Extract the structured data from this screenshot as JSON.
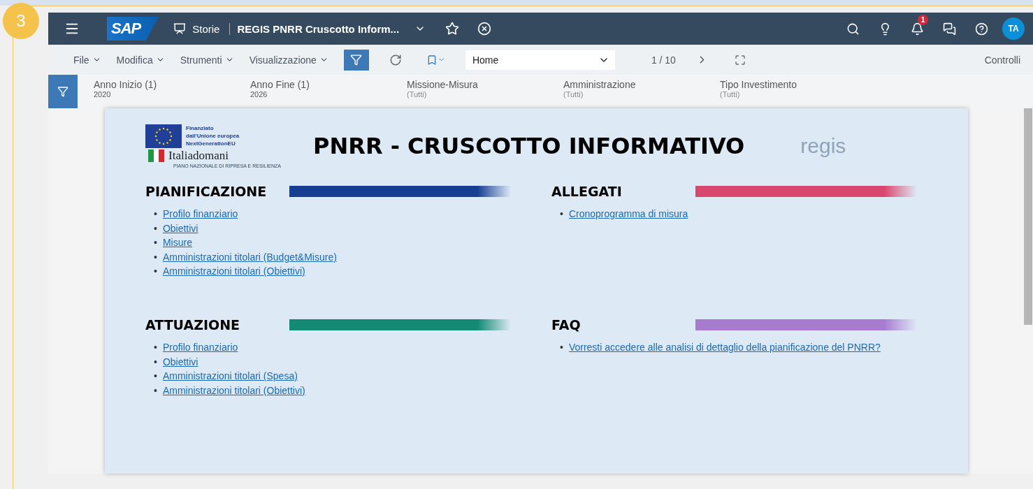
{
  "step": "3",
  "shellbar": {
    "logo": "SAP",
    "app": "Storie",
    "story": "REGIS PNRR Cruscotto Inform...",
    "notifications": "1",
    "avatar": "TA"
  },
  "menubar": {
    "menus": [
      "File",
      "Modifica",
      "Strumenti",
      "Visualizzazione"
    ],
    "page_select": "Home",
    "page": "1 / 10",
    "controls": "Controlli"
  },
  "filters": [
    {
      "label": "Anno Inizio (1)",
      "value": "2020"
    },
    {
      "label": "Anno Fine (1)",
      "value": "2026"
    },
    {
      "label": "Missione-Misura",
      "value": "(Tutti)"
    },
    {
      "label": "Amministrazione",
      "value": "(Tutti)"
    },
    {
      "label": "Tipo Investimento",
      "value": "(Tutti)"
    }
  ],
  "dashboard": {
    "logo": {
      "eu_lines": [
        "Finanziato",
        "dall'Unione europea",
        "NextGenerationEU"
      ],
      "name": "Italiadomani",
      "subtitle": "PIANO NAZIONALE DI RIPRESA E RESILIENZA"
    },
    "title": "PNRR - CRUSCOTTO INFORMATIVO",
    "brand": "regis",
    "bullet": "•",
    "sections": [
      {
        "title": "PIANIFICAZIONE",
        "color": "#163f93",
        "links": [
          "Profilo finanziario",
          "Obiettivi",
          "Misure",
          "Amministrazioni titolari (Budget&Misure)",
          "Amministrazioni titolari (Obiettivi)"
        ]
      },
      {
        "title": "ALLEGATI",
        "color": "#d9466e",
        "links": [
          "Cronoprogramma di misura"
        ]
      },
      {
        "title": "ATTUAZIONE",
        "color": "#138a74",
        "links": [
          "Profilo finanziario",
          "Obiettivi",
          "Amministrazioni titolari (Spesa)",
          "Amministrazioni titolari (Obiettivi)"
        ]
      },
      {
        "title": "FAQ",
        "color": "#a77bd0",
        "links": [
          "Vorresti accedere alle analisi di dettaglio della pianificazione del PNRR?"
        ]
      }
    ]
  }
}
